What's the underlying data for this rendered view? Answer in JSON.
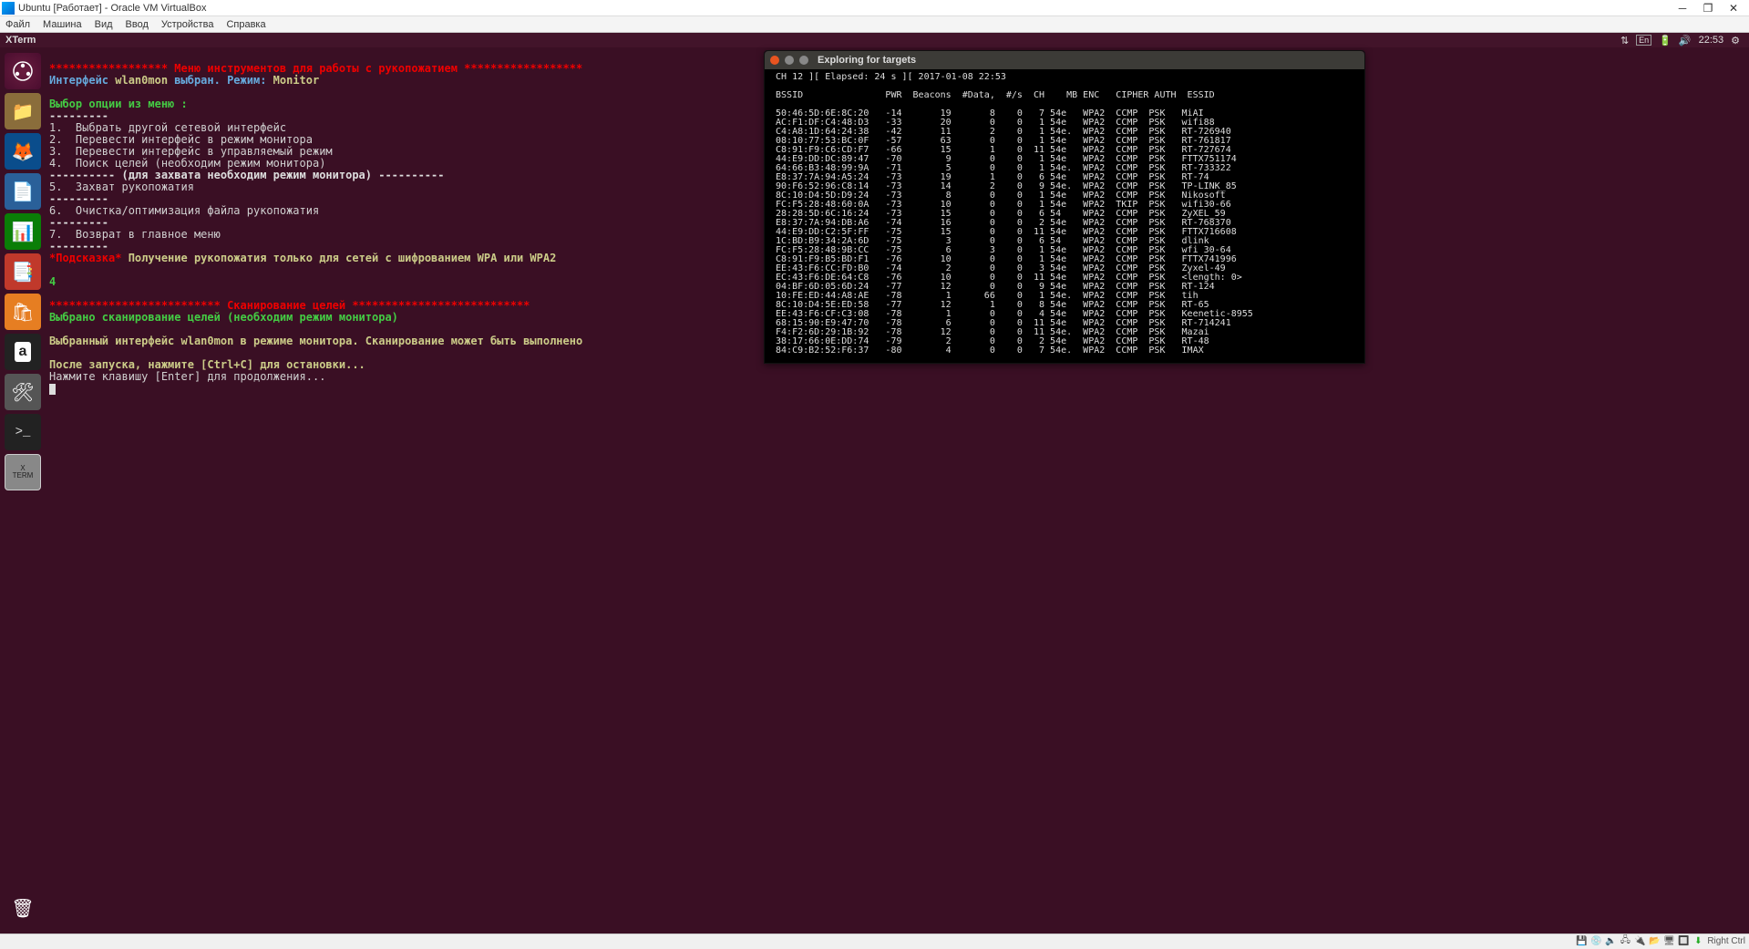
{
  "window": {
    "title": "Ubuntu [Работает] - Oracle VM VirtualBox"
  },
  "menubar": [
    "Файл",
    "Машина",
    "Вид",
    "Ввод",
    "Устройства",
    "Справка"
  ],
  "ubuntu_panel": {
    "title": "XTerm",
    "lang": "En",
    "time": "22:53"
  },
  "xterm": {
    "star1": "****************** Меню инструментов для работы с рукопожатием ******************",
    "iface_line_prefix": "Интерфейс ",
    "iface_name": "wlan0mon",
    "iface_mid": " выбран. ",
    "mode_label": "Режим: ",
    "mode_value": "Monitor",
    "select_prompt": "Выбор опции из меню :",
    "opt1": "1.  Выбрать другой сетевой интерфейс",
    "opt2": "2.  Перевести интерфейс в режим монитора",
    "opt3": "3.  Перевести интерфейс в управляемый режим",
    "opt4": "4.  Поиск целей (необходим режим монитора)",
    "sep_line": "---------- (для захвата необходим режим монитора) ----------",
    "opt5": "5.  Захват рукопожатия",
    "sep_dashes": "---------",
    "opt6": "6.  Очистка/оптимизация файла рукопожатия",
    "opt7": "7.  Возврат в главное меню",
    "hint_prefix": "*Подсказка*",
    "hint_text": " Получение рукопожатия только для сетей с шифрованием WPA или WPA2",
    "entered": "4",
    "star2": "************************** Сканирование целей ***************************",
    "scan_selected": "Выбрано сканирование целей (необходим режим монитора)",
    "scan_iface": "Выбранный интерфейс wlan0mon в режиме монитора. Сканирование может быть выполнено",
    "after_start": "После запуска, нажмите [Ctrl+C] для остановки...",
    "press_enter": "Нажмите клавишу [Enter] для продолжения..."
  },
  "targets": {
    "title": "Exploring for targets",
    "summary": "CH 12 ][ Elapsed: 24 s ][ 2017-01-08 22:53",
    "header": [
      "BSSID",
      "PWR",
      "Beacons",
      "#Data,",
      "#/s",
      "CH",
      "MB",
      "ENC",
      "CIPHER",
      "AUTH",
      "ESSID"
    ],
    "rows": [
      [
        "50:46:5D:6E:8C:20",
        "-14",
        "19",
        "8",
        "0",
        "7",
        "54e",
        "WPA2",
        "CCMP",
        "PSK",
        "MiAI"
      ],
      [
        "AC:F1:DF:C4:48:D3",
        "-33",
        "20",
        "0",
        "0",
        "1",
        "54e",
        "WPA2",
        "CCMP",
        "PSK",
        "wifi88"
      ],
      [
        "C4:A8:1D:64:24:38",
        "-42",
        "11",
        "2",
        "0",
        "1",
        "54e.",
        "WPA2",
        "CCMP",
        "PSK",
        "RT-726940"
      ],
      [
        "08:10:77:53:BC:0F",
        "-57",
        "63",
        "0",
        "0",
        "1",
        "54e",
        "WPA2",
        "CCMP",
        "PSK",
        "RT-761817"
      ],
      [
        "C8:91:F9:C6:CD:F7",
        "-66",
        "15",
        "1",
        "0",
        "11",
        "54e",
        "WPA2",
        "CCMP",
        "PSK",
        "RT-727674"
      ],
      [
        "44:E9:DD:DC:89:47",
        "-70",
        "9",
        "0",
        "0",
        "1",
        "54e",
        "WPA2",
        "CCMP",
        "PSK",
        "FTTX751174"
      ],
      [
        "64:66:B3:48:99:9A",
        "-71",
        "5",
        "0",
        "0",
        "1",
        "54e.",
        "WPA2",
        "CCMP",
        "PSK",
        "RT-733322"
      ],
      [
        "E8:37:7A:94:A5:24",
        "-73",
        "19",
        "1",
        "0",
        "6",
        "54e",
        "WPA2",
        "CCMP",
        "PSK",
        "RT-74"
      ],
      [
        "90:F6:52:96:C8:14",
        "-73",
        "14",
        "2",
        "0",
        "9",
        "54e.",
        "WPA2",
        "CCMP",
        "PSK",
        "TP-LINK_85"
      ],
      [
        "8C:10:D4:5D:D9:24",
        "-73",
        "8",
        "0",
        "0",
        "1",
        "54e",
        "WPA2",
        "CCMP",
        "PSK",
        "Nikosoft"
      ],
      [
        "FC:F5:28:48:60:0A",
        "-73",
        "10",
        "0",
        "0",
        "1",
        "54e",
        "WPA2",
        "TKIP",
        "PSK",
        "wifi30-66"
      ],
      [
        "28:28:5D:6C:16:24",
        "-73",
        "15",
        "0",
        "0",
        "6",
        "54",
        "WPA2",
        "CCMP",
        "PSK",
        "ZyXEL_59"
      ],
      [
        "E8:37:7A:94:DB:A6",
        "-74",
        "16",
        "0",
        "0",
        "2",
        "54e",
        "WPA2",
        "CCMP",
        "PSK",
        "RT-768370"
      ],
      [
        "44:E9:DD:C2:5F:FF",
        "-75",
        "15",
        "0",
        "0",
        "11",
        "54e",
        "WPA2",
        "CCMP",
        "PSK",
        "FTTX716608"
      ],
      [
        "1C:BD:B9:34:2A:6D",
        "-75",
        "3",
        "0",
        "0",
        "6",
        "54",
        "WPA2",
        "CCMP",
        "PSK",
        "dlink"
      ],
      [
        "FC:F5:28:48:9B:CC",
        "-75",
        "6",
        "3",
        "0",
        "1",
        "54e",
        "WPA2",
        "CCMP",
        "PSK",
        "wfi 30-64"
      ],
      [
        "C8:91:F9:B5:BD:F1",
        "-76",
        "10",
        "0",
        "0",
        "1",
        "54e",
        "WPA2",
        "CCMP",
        "PSK",
        "FTTX741996"
      ],
      [
        "EE:43:F6:CC:FD:B0",
        "-74",
        "2",
        "0",
        "0",
        "3",
        "54e",
        "WPA2",
        "CCMP",
        "PSK",
        "Zyxel-49"
      ],
      [
        "EC:43:F6:DE:64:C8",
        "-76",
        "10",
        "0",
        "0",
        "11",
        "54e",
        "WPA2",
        "CCMP",
        "PSK",
        "<length: 0>"
      ],
      [
        "04:BF:6D:05:6D:24",
        "-77",
        "12",
        "0",
        "0",
        "9",
        "54e",
        "WPA2",
        "CCMP",
        "PSK",
        "RT-124"
      ],
      [
        "10:FE:ED:44:A8:AE",
        "-78",
        "1",
        "66",
        "0",
        "1",
        "54e.",
        "WPA2",
        "CCMP",
        "PSK",
        "tih"
      ],
      [
        "8C:10:D4:5E:ED:58",
        "-77",
        "12",
        "1",
        "0",
        "8",
        "54e",
        "WPA2",
        "CCMP",
        "PSK",
        "RT-65"
      ],
      [
        "EE:43:F6:CF:C3:08",
        "-78",
        "1",
        "0",
        "0",
        "4",
        "54e",
        "WPA2",
        "CCMP",
        "PSK",
        "Keenetic-8955"
      ],
      [
        "68:15:90:E9:47:70",
        "-78",
        "6",
        "0",
        "0",
        "11",
        "54e",
        "WPA2",
        "CCMP",
        "PSK",
        "RT-714241"
      ],
      [
        "F4:F2:6D:29:1B:92",
        "-78",
        "12",
        "0",
        "0",
        "11",
        "54e.",
        "WPA2",
        "CCMP",
        "PSK",
        "Mazai"
      ],
      [
        "38:17:66:0E:DD:74",
        "-79",
        "2",
        "0",
        "0",
        "2",
        "54e",
        "WPA2",
        "CCMP",
        "PSK",
        "RT-48"
      ],
      [
        "84:C9:B2:52:F6:37",
        "-80",
        "4",
        "0",
        "0",
        "7",
        "54e.",
        "WPA2",
        "CCMP",
        "PSK",
        "IMAX"
      ]
    ]
  },
  "statusbar": {
    "right_ctrl": "Right Ctrl"
  }
}
